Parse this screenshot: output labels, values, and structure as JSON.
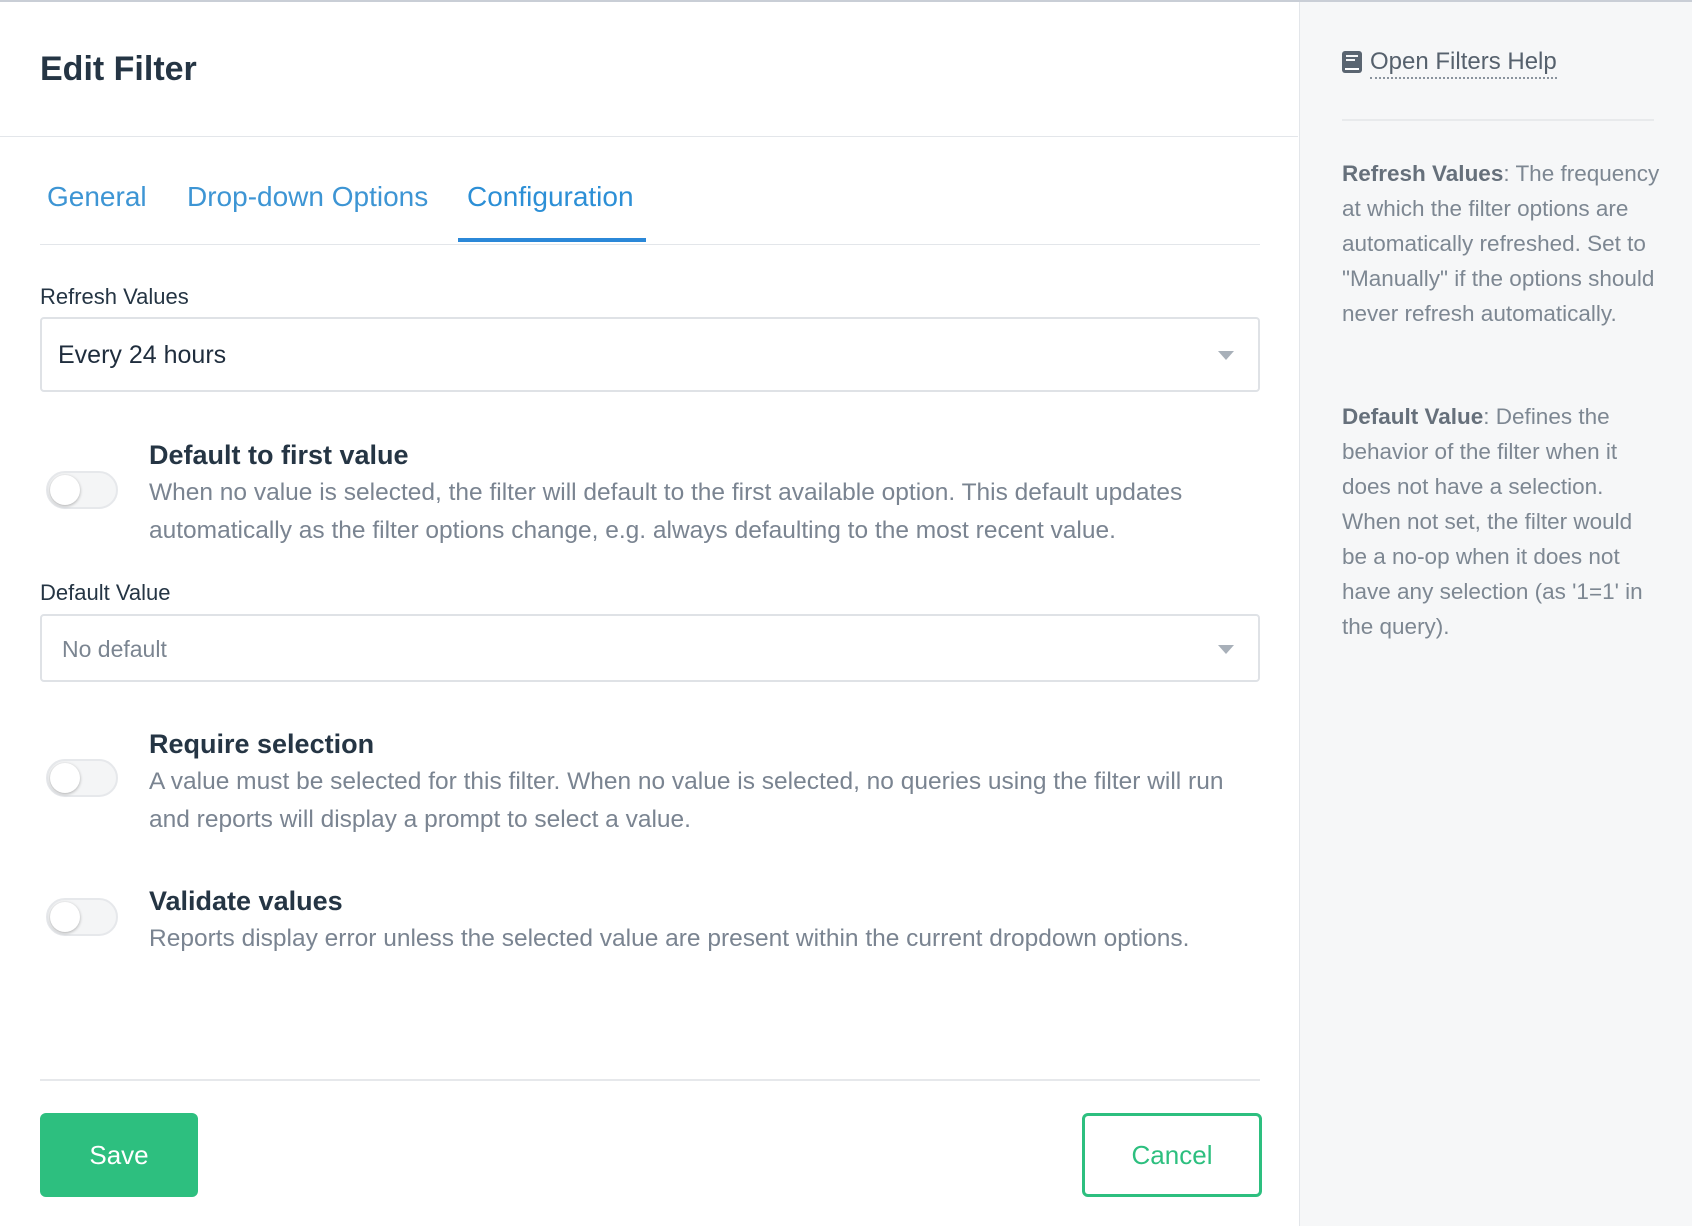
{
  "dialog": {
    "title": "Edit Filter"
  },
  "tabs": [
    {
      "label": "General",
      "active": false
    },
    {
      "label": "Drop-down Options",
      "active": false
    },
    {
      "label": "Configuration",
      "active": true
    }
  ],
  "refresh": {
    "label": "Refresh Values",
    "selected": "Every 24 hours"
  },
  "options": {
    "default_first": {
      "title": "Default to first value",
      "description": "When no value is selected, the filter will default to the first available option. This default updates automatically as the filter options change, e.g. always defaulting to the most recent value.",
      "enabled": false
    },
    "require_selection": {
      "title": "Require selection",
      "description": "A value must be selected for this filter. When no value is selected, no queries using the filter will run and reports will display a prompt to select a value.",
      "enabled": false
    },
    "validate_values": {
      "title": "Validate values",
      "description": "Reports display error unless the selected value are present within the current dropdown options.",
      "enabled": false
    }
  },
  "default_value": {
    "label": "Default Value",
    "placeholder": "No default"
  },
  "footer": {
    "save_label": "Save",
    "cancel_label": "Cancel"
  },
  "help": {
    "link_label": "Open Filters Help",
    "refresh": {
      "term": "Refresh Values",
      "text": ": The frequency at which the filter options are automatically refreshed. Set to \"Manually\" if the options should never refresh automatically."
    },
    "default": {
      "term": "Default Value",
      "text": ": Defines the behavior of the filter when it does not have a selection. When not set, the filter would be a no-op when it does not have any selection (as '1=1' in the query)."
    }
  },
  "colors": {
    "accent": "#2b88d8",
    "primary_button": "#2dbf7f",
    "title_text": "#253544",
    "muted_text": "#7a8491"
  }
}
